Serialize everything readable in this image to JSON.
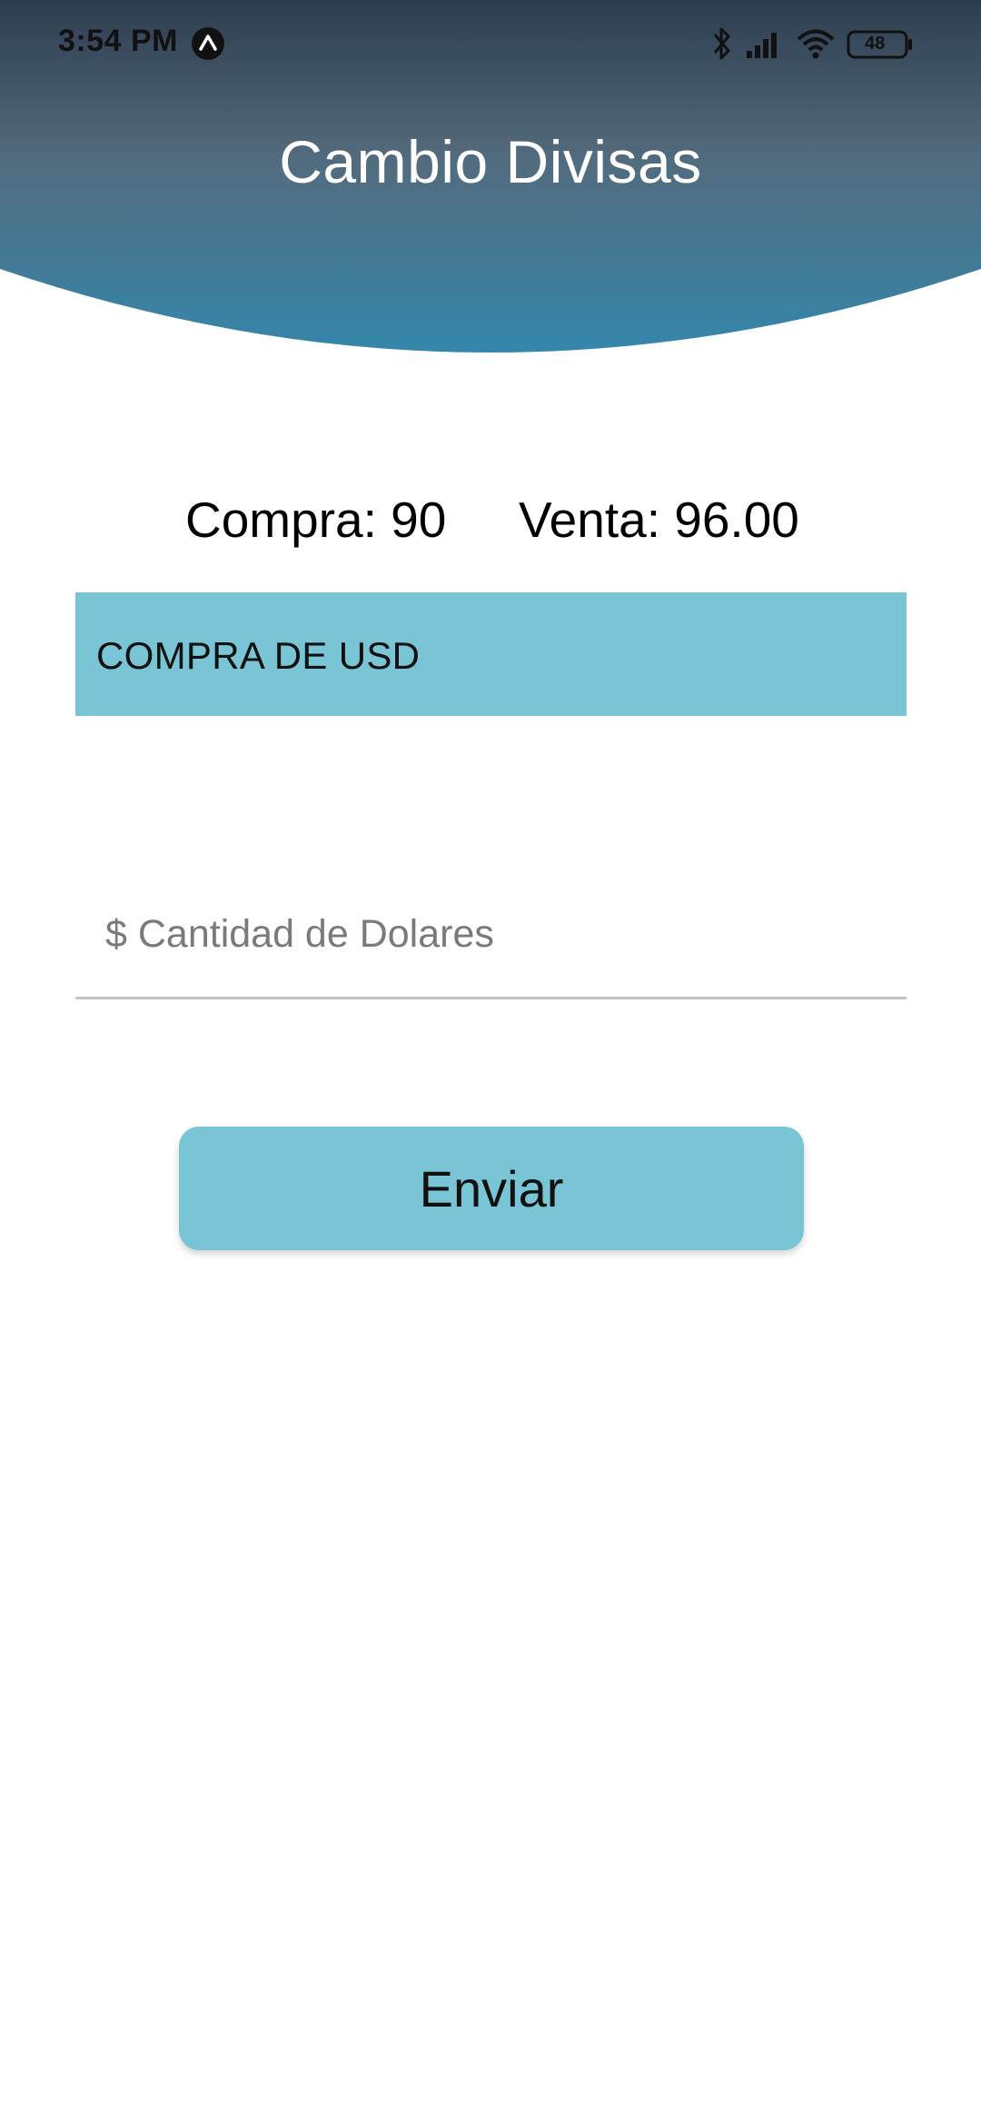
{
  "status_bar": {
    "time": "3:54 PM",
    "battery": "48",
    "icons": [
      "app-notification-icon",
      "bluetooth-icon",
      "cellular-signal-icon",
      "wifi-icon",
      "battery-icon"
    ]
  },
  "header": {
    "title": "Cambio Divisas",
    "gradient_top": "#2d3d4e",
    "gradient_bottom": "#3a8bab"
  },
  "rates": {
    "buy": "Compra: 90",
    "sell": "Venta: 96.00"
  },
  "picker": {
    "selected": "COMPRA DE USD"
  },
  "amount": {
    "placeholder": "$ Cantidad de Dolares",
    "value": ""
  },
  "actions": {
    "send_label": "Enviar"
  },
  "colors": {
    "accent": "#79c5d5",
    "background": "#ffffff"
  }
}
